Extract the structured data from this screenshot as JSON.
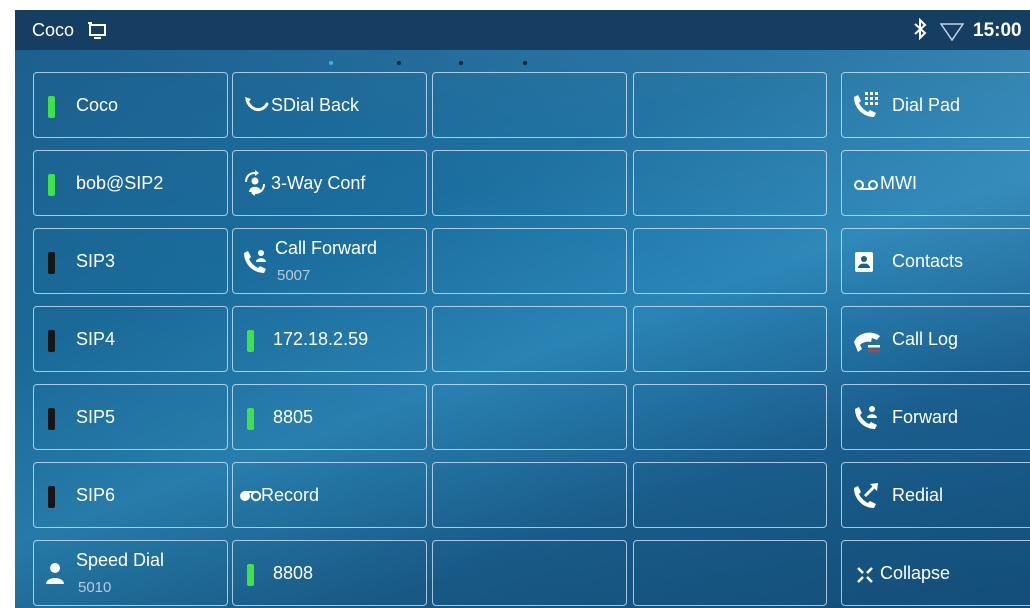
{
  "status_bar": {
    "title": "Coco",
    "time": "15:00",
    "icons": [
      "monitor-icon",
      "bluetooth-icon",
      "wifi-icon"
    ]
  },
  "page_dots": {
    "count": 4,
    "active_index": 0
  },
  "line_keys": [
    {
      "label": "Coco",
      "indicator": "green"
    },
    {
      "label": "bob@SIP2",
      "indicator": "green"
    },
    {
      "label": "SIP3",
      "indicator": "dark"
    },
    {
      "label": "SIP4",
      "indicator": "dark"
    },
    {
      "label": "SIP5",
      "indicator": "dark"
    },
    {
      "label": "SIP6",
      "indicator": "dark"
    },
    {
      "label": "Speed Dial",
      "sub": "5010",
      "icon": "contact-icon"
    }
  ],
  "function_keys": [
    {
      "label": "SDial Back",
      "icon": "callback-icon"
    },
    {
      "label": "3-Way Conf",
      "icon": "conference-icon"
    },
    {
      "label": "Call Forward",
      "sub": "5007",
      "icon": "call-forward-icon"
    },
    {
      "label": "172.18.2.59",
      "indicator": "green"
    },
    {
      "label": "8805",
      "indicator": "green"
    },
    {
      "label": "Record",
      "icon": "record-icon"
    },
    {
      "label": "8808",
      "indicator": "green"
    }
  ],
  "side_menu": [
    {
      "label": "Dial Pad",
      "icon": "dialpad-icon"
    },
    {
      "label": "MWI",
      "icon": "voicemail-icon"
    },
    {
      "label": "Contacts",
      "icon": "contacts-icon"
    },
    {
      "label": "Call Log",
      "icon": "call-log-icon"
    },
    {
      "label": "Forward",
      "icon": "forward-icon"
    },
    {
      "label": "Redial",
      "icon": "redial-icon"
    },
    {
      "label": "Collapse",
      "icon": "collapse-icon"
    }
  ],
  "colors": {
    "status_bar": "#163e62",
    "indicator_green": "#3ee34a",
    "indicator_dark": "#161616",
    "active_dot": "#37b2ee"
  }
}
